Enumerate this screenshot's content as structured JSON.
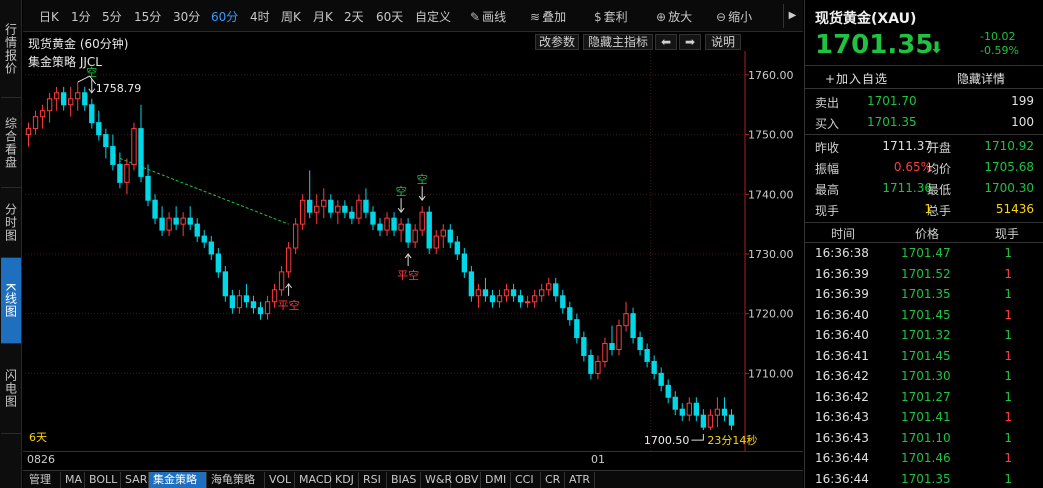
{
  "left_tabs": [
    {
      "label": "行情报价",
      "active": false
    },
    {
      "label": "综合看盘",
      "active": false
    },
    {
      "label": "分时图",
      "active": false
    },
    {
      "label": "K线图",
      "active": true
    },
    {
      "label": "闪电图",
      "active": false
    }
  ],
  "toolbar": {
    "periods": [
      "日K",
      "1分",
      "5分",
      "15分",
      "30分",
      "60分",
      "4时",
      "周K",
      "月K",
      "2天",
      "60天",
      "自定义"
    ],
    "active_period": "60分",
    "tools": [
      {
        "icon": "pencil-icon",
        "glyph": "✎",
        "label": "画线"
      },
      {
        "icon": "stack-icon",
        "glyph": "≋",
        "label": "叠加"
      },
      {
        "icon": "moneybag-icon",
        "glyph": "$",
        "label": "套利"
      },
      {
        "icon": "zoom-in-icon",
        "glyph": "⊕",
        "label": "放大"
      },
      {
        "icon": "zoom-out-icon",
        "glyph": "⊖",
        "label": "缩小"
      }
    ],
    "collapse_glyph": "▶"
  },
  "chart_header": {
    "title": "现货黄金 (60分钟)",
    "buttons": {
      "modify": "改参数",
      "hide": "隐藏主指标",
      "left": "⬅",
      "right": "➡",
      "help": "说明"
    }
  },
  "indicator": {
    "name": "集金策略 JJCL"
  },
  "chart_data": {
    "type": "candlestick",
    "title": "现货黄金 (60分钟)",
    "ylim": [
      1697,
      1764
    ],
    "y_ticks": [
      1760,
      1750,
      1740,
      1730,
      1720,
      1710
    ],
    "x_ticks": [
      {
        "index": 0,
        "label": "0826"
      },
      {
        "index": 89,
        "label": "01"
      }
    ],
    "candles": [
      [
        1750,
        1752,
        1748,
        1751
      ],
      [
        1751,
        1754,
        1750,
        1753
      ],
      [
        1753,
        1755,
        1751,
        1754
      ],
      [
        1754,
        1757,
        1752,
        1756
      ],
      [
        1756,
        1758,
        1754,
        1757
      ],
      [
        1757,
        1758,
        1754,
        1755
      ],
      [
        1755,
        1758,
        1753,
        1756
      ],
      [
        1756,
        1758.79,
        1754,
        1757
      ],
      [
        1757,
        1758,
        1754,
        1755
      ],
      [
        1755,
        1756,
        1751,
        1752
      ],
      [
        1752,
        1754,
        1749,
        1750
      ],
      [
        1750,
        1751,
        1746,
        1748
      ],
      [
        1748,
        1750,
        1744,
        1745
      ],
      [
        1745,
        1747,
        1741,
        1742
      ],
      [
        1742,
        1746,
        1740,
        1745
      ],
      [
        1745,
        1752,
        1744,
        1751
      ],
      [
        1751,
        1755,
        1742,
        1743
      ],
      [
        1743,
        1745,
        1738,
        1739
      ],
      [
        1739,
        1740,
        1735,
        1736
      ],
      [
        1736,
        1738,
        1733,
        1734
      ],
      [
        1734,
        1737,
        1733,
        1736
      ],
      [
        1736,
        1738,
        1734,
        1735
      ],
      [
        1735,
        1737,
        1733,
        1736
      ],
      [
        1736,
        1738,
        1734,
        1735
      ],
      [
        1735,
        1736,
        1732,
        1733
      ],
      [
        1733,
        1734,
        1731,
        1732
      ],
      [
        1732,
        1733,
        1729,
        1730
      ],
      [
        1730,
        1731,
        1726,
        1727
      ],
      [
        1727,
        1728,
        1722,
        1723
      ],
      [
        1723,
        1724,
        1720,
        1721
      ],
      [
        1721,
        1724,
        1720,
        1723
      ],
      [
        1723,
        1725,
        1721,
        1722
      ],
      [
        1722,
        1723,
        1720,
        1721
      ],
      [
        1721,
        1722,
        1719,
        1720
      ],
      [
        1720,
        1723,
        1719,
        1722
      ],
      [
        1722,
        1725,
        1721,
        1724
      ],
      [
        1724,
        1728,
        1723,
        1727
      ],
      [
        1727,
        1732,
        1726,
        1731
      ],
      [
        1731,
        1736,
        1730,
        1735
      ],
      [
        1735,
        1740,
        1734,
        1739
      ],
      [
        1739,
        1744,
        1736,
        1737
      ],
      [
        1737,
        1740,
        1735,
        1738
      ],
      [
        1738,
        1741,
        1736,
        1739
      ],
      [
        1739,
        1740,
        1736,
        1737
      ],
      [
        1737,
        1739,
        1735,
        1738
      ],
      [
        1738,
        1739,
        1736,
        1737
      ],
      [
        1737,
        1738,
        1735,
        1736
      ],
      [
        1736,
        1740,
        1735,
        1739
      ],
      [
        1739,
        1741,
        1736,
        1737
      ],
      [
        1737,
        1738,
        1734,
        1735
      ],
      [
        1735,
        1736,
        1733,
        1734
      ],
      [
        1734,
        1737,
        1733,
        1736
      ],
      [
        1736,
        1737,
        1733,
        1734
      ],
      [
        1734,
        1736,
        1732,
        1735
      ],
      [
        1735,
        1736,
        1731,
        1732
      ],
      [
        1732,
        1735,
        1731,
        1734
      ],
      [
        1734,
        1738,
        1733,
        1737
      ],
      [
        1737,
        1738,
        1730,
        1731
      ],
      [
        1731,
        1734,
        1730,
        1733
      ],
      [
        1733,
        1735,
        1731,
        1734
      ],
      [
        1734,
        1735,
        1731,
        1732
      ],
      [
        1732,
        1733,
        1729,
        1730
      ],
      [
        1730,
        1731,
        1726,
        1727
      ],
      [
        1727,
        1728,
        1722,
        1723
      ],
      [
        1723,
        1725,
        1721,
        1724
      ],
      [
        1724,
        1726,
        1722,
        1723
      ],
      [
        1723,
        1724,
        1721,
        1722
      ],
      [
        1722,
        1724,
        1721,
        1723
      ],
      [
        1723,
        1725,
        1722,
        1724
      ],
      [
        1724,
        1725,
        1722,
        1723
      ],
      [
        1723,
        1724,
        1721,
        1722
      ],
      [
        1722,
        1723,
        1721,
        1722
      ],
      [
        1722,
        1724,
        1721,
        1723
      ],
      [
        1723,
        1725,
        1722,
        1724
      ],
      [
        1724,
        1726,
        1723,
        1725
      ],
      [
        1725,
        1726,
        1722,
        1723
      ],
      [
        1723,
        1724,
        1720,
        1721
      ],
      [
        1721,
        1722,
        1718,
        1719
      ],
      [
        1719,
        1720,
        1715,
        1716
      ],
      [
        1716,
        1717,
        1712,
        1713
      ],
      [
        1713,
        1714,
        1709,
        1710
      ],
      [
        1710,
        1713,
        1709,
        1712
      ],
      [
        1712,
        1716,
        1711,
        1715
      ],
      [
        1715,
        1718,
        1713,
        1714
      ],
      [
        1714,
        1719,
        1713,
        1718
      ],
      [
        1718,
        1722,
        1717,
        1720
      ],
      [
        1720,
        1721,
        1715,
        1716
      ],
      [
        1716,
        1717,
        1713,
        1714
      ],
      [
        1714,
        1715,
        1711,
        1712
      ],
      [
        1712,
        1713,
        1709,
        1710
      ],
      [
        1710,
        1711,
        1707,
        1708
      ],
      [
        1708,
        1709,
        1705,
        1706
      ],
      [
        1706,
        1707,
        1703,
        1704
      ],
      [
        1704,
        1705,
        1702,
        1703
      ],
      [
        1703,
        1706,
        1702,
        1705
      ],
      [
        1705,
        1706,
        1702,
        1703
      ],
      [
        1703,
        1704,
        1700.5,
        1701
      ],
      [
        1701,
        1704,
        1700.5,
        1703
      ],
      [
        1703,
        1706,
        1701,
        1704
      ],
      [
        1704,
        1706,
        1702,
        1703
      ],
      [
        1703,
        1704,
        1700.5,
        1701.35
      ]
    ],
    "trend_line": {
      "from_index": 13,
      "from_value": 1746,
      "to_index": 37,
      "to_value": 1735,
      "color": "#1ec33f"
    },
    "signals": [
      {
        "index": 9,
        "type": "short",
        "label": "空",
        "color": "#1ec33f"
      },
      {
        "index": 37,
        "type": "cover",
        "label": "平空",
        "color": "#ff3b3b"
      },
      {
        "index": 53,
        "type": "short",
        "label": "空",
        "color": "#1ec33f"
      },
      {
        "index": 54,
        "type": "cover",
        "label": "平空",
        "color": "#ff3b3b"
      },
      {
        "index": 56,
        "type": "short",
        "label": "空",
        "color": "#1ec33f"
      }
    ],
    "high_annotation": {
      "index": 7,
      "value": 1758.79,
      "label": "1758.79"
    },
    "low_annotation": {
      "index": 96,
      "value": 1700.5,
      "label": "1700.50"
    },
    "countdown": "23分14秒",
    "days_label": "6天",
    "colors": {
      "up": "#ff3b3b",
      "down": "#00d8e8",
      "grid": "#3a1a1a",
      "axis": "#aa2222"
    }
  },
  "bottom": {
    "date_left": "0826",
    "date_mid": "01",
    "indicator_tabs": [
      "管理",
      "MA",
      "BOLL",
      "SAR",
      "集金策略",
      "海龟策略",
      "VOL",
      "MACD",
      "KDJ",
      "RSI",
      "BIAS",
      "W&R",
      "OBV",
      "DMI",
      "CCI",
      "CR",
      "ATR"
    ],
    "active_indicator": "集金策略"
  },
  "quote": {
    "name": "现货黄金(XAU)",
    "price": "1701.35",
    "change": "-10.02",
    "change_pct": "-0.59%",
    "add_watchlist": "+加入自选",
    "hide_detail": "隐藏详情",
    "sell": {
      "label": "卖出",
      "price": "1701.70",
      "vol": "199"
    },
    "buy": {
      "label": "买入",
      "price": "1701.35",
      "vol": "100"
    },
    "stats": [
      {
        "l1": "昨收",
        "v1": "1711.37",
        "c1": "w",
        "l2": "开盘",
        "v2": "1710.92",
        "c2": "g"
      },
      {
        "l1": "振幅",
        "v1": "0.65%",
        "c1": "r",
        "l2": "均价",
        "v2": "1705.68",
        "c2": "g"
      },
      {
        "l1": "最高",
        "v1": "1711.36",
        "c1": "g",
        "l2": "最低",
        "v2": "1700.30",
        "c2": "g"
      },
      {
        "l1": "现手",
        "v1": "1",
        "c1": "y",
        "l2": "总手",
        "v2": "51436",
        "c2": "y"
      }
    ],
    "ticks_header": {
      "time": "时间",
      "price": "价格",
      "vol": "现手"
    },
    "ticks": [
      {
        "time": "16:36:38",
        "price": "1701.47",
        "vol": "1",
        "dir": "g"
      },
      {
        "time": "16:36:39",
        "price": "1701.52",
        "vol": "1",
        "dir": "r"
      },
      {
        "time": "16:36:39",
        "price": "1701.35",
        "vol": "1",
        "dir": "g"
      },
      {
        "time": "16:36:40",
        "price": "1701.45",
        "vol": "1",
        "dir": "r"
      },
      {
        "time": "16:36:40",
        "price": "1701.32",
        "vol": "1",
        "dir": "g"
      },
      {
        "time": "16:36:41",
        "price": "1701.45",
        "vol": "1",
        "dir": "r"
      },
      {
        "time": "16:36:42",
        "price": "1701.30",
        "vol": "1",
        "dir": "g"
      },
      {
        "time": "16:36:42",
        "price": "1701.27",
        "vol": "1",
        "dir": "g"
      },
      {
        "time": "16:36:43",
        "price": "1701.41",
        "vol": "1",
        "dir": "r"
      },
      {
        "time": "16:36:43",
        "price": "1701.10",
        "vol": "1",
        "dir": "g"
      },
      {
        "time": "16:36:44",
        "price": "1701.46",
        "vol": "1",
        "dir": "r"
      },
      {
        "time": "16:36:44",
        "price": "1701.35",
        "vol": "1",
        "dir": "g"
      }
    ]
  }
}
